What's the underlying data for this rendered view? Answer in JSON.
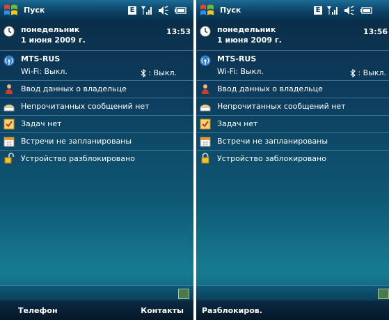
{
  "screens": [
    {
      "start_label": "Пуск",
      "network_indicator": "E",
      "clock": {
        "day": "понедельник",
        "date": "1 июня 2009 г.",
        "time": "13:53"
      },
      "network": {
        "operator": "MTS-RUS",
        "wifi": "Wi-Fi: Выкл.",
        "bluetooth": ": Выкл."
      },
      "owner": "Ввод данных о владельце",
      "messages": "Непрочитанных сообщений нет",
      "tasks": "Задач нет",
      "appointments": "Встречи не запланированы",
      "lock_status": "Устройство разблокировано",
      "softkeys": {
        "left": "Телефон",
        "right": "Контакты"
      }
    },
    {
      "start_label": "Пуск",
      "network_indicator": "E",
      "clock": {
        "day": "понедельник",
        "date": "1 июня 2009 г.",
        "time": "13:56"
      },
      "network": {
        "operator": "MTS-RUS",
        "wifi": "Wi-Fi: Выкл.",
        "bluetooth": ": Выкл."
      },
      "owner": "Ввод данных о владельце",
      "messages": "Непрочитанных сообщений нет",
      "tasks": "Задач нет",
      "appointments": "Встречи не запланированы",
      "lock_status": "Устройство заблокировано",
      "softkeys": {
        "left": "Разблокиров.",
        "right": ""
      }
    }
  ],
  "icons": {
    "start": "windows-flag-icon",
    "edge": "edge-network-icon",
    "signal": "signal-strength-icon",
    "volume": "speaker-icon",
    "battery": "battery-icon",
    "clock": "clock-icon",
    "wifi": "antenna-icon",
    "bluetooth": "bluetooth-icon",
    "owner": "owner-person-icon",
    "messages": "envelope-icon",
    "tasks": "task-checkbox-icon",
    "calendar": "calendar-icon",
    "lock_open": "unlocked-padlock-icon",
    "lock_closed": "locked-padlock-icon",
    "graph": "status-graph-icon"
  },
  "colors": {
    "background": "#0d3d5e",
    "titlebar": "#0d4569",
    "text": "#ffffff",
    "separator": "#78b4d2"
  }
}
